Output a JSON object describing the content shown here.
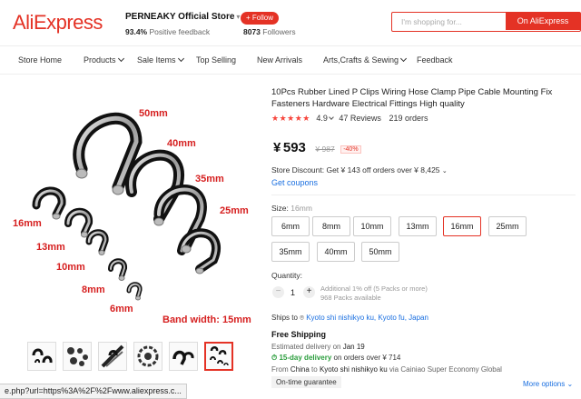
{
  "header": {
    "logo": "AliExpress",
    "store_name": "PERNEAKY Official Store",
    "positive_feedback_value": "93.4%",
    "positive_feedback_label": "Positive feedback",
    "follow_label": "+ Follow",
    "followers_value": "8073",
    "followers_label": "Followers",
    "search_placeholder": "I'm shopping for...",
    "search_button": "On AliExpress"
  },
  "nav": {
    "items": [
      {
        "label": "Store Home",
        "has_dropdown": false
      },
      {
        "label": "Products",
        "has_dropdown": true
      },
      {
        "label": "Sale Items",
        "has_dropdown": true
      },
      {
        "label": "Top Selling",
        "has_dropdown": false
      },
      {
        "label": "New Arrivals",
        "has_dropdown": false
      },
      {
        "label": "Arts,Crafts & Sewing",
        "has_dropdown": true
      },
      {
        "label": "Feedback",
        "has_dropdown": false
      }
    ]
  },
  "gallery": {
    "labels": {
      "s50": "50mm",
      "s40": "40mm",
      "s35": "35mm",
      "s25": "25mm",
      "s16": "16mm",
      "s13": "13mm",
      "s10": "10mm",
      "s8": "8mm",
      "s6": "6mm",
      "band": "Band width: 15mm"
    },
    "thumbnail_count": 6,
    "active_thumbnail": 6
  },
  "status_bar_url": "e.php?url=https%3A%2F%2Fwww.aliexpress.c...",
  "product": {
    "title": "10Pcs Rubber Lined P Clips Wiring Hose Clamp Pipe Cable Mounting Fix Fasteners Hardware Electrical Fittings High quality",
    "rating": "4.9",
    "reviews": "47 Reviews",
    "orders": "219 orders",
    "currency": "¥",
    "price": "593",
    "old_price": "¥ 987",
    "discount": "-40%",
    "store_discount": "Store Discount: Get ¥ 143 off orders over ¥ 8,425",
    "get_coupons": "Get coupons",
    "size_label": "Size:",
    "size_selected": "16mm",
    "sizes": [
      "6mm",
      "8mm",
      "10mm",
      "13mm",
      "16mm",
      "25mm",
      "35mm",
      "40mm",
      "50mm"
    ],
    "quantity_label": "Quantity:",
    "quantity": "1",
    "qty_note_1": "Additional 1% off (5 Packs or more)",
    "qty_note_2": "968 Packs available",
    "ships_to_label": "Ships to",
    "ships_to_location": "Kyoto shi nishikyo ku, Kyoto fu, Japan",
    "free_shipping": "Free Shipping",
    "estimated_label": "Estimated delivery on",
    "estimated_date": "Jan 19",
    "fast_delivery": "15-day delivery",
    "fast_delivery_rest": "on orders over ¥ 714",
    "from_label": "From",
    "from_country": "China",
    "to_label": "to",
    "to_location": "Kyoto shi nishikyo ku",
    "via": "via Cainiao Super Economy Global",
    "on_time_guarantee": "On-time guarantee",
    "more_options": "More options"
  },
  "colors": {
    "brand_red": "#e43225",
    "link_blue": "#1a6fe0",
    "star_red": "#f7453c",
    "delivery_green": "#2a9d3c",
    "image_label_red": "#d62020"
  }
}
